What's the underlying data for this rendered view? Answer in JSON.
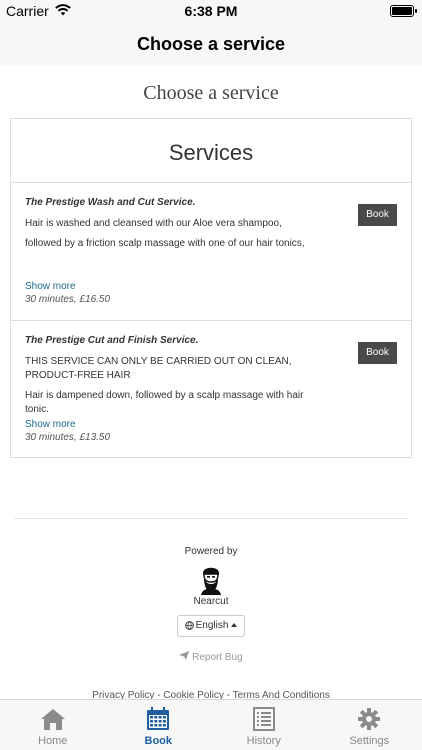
{
  "status_bar": {
    "carrier": "Carrier",
    "time": "6:38 PM"
  },
  "nav": {
    "title": "Choose a service"
  },
  "main": {
    "heading": "Choose a service",
    "panel_title": "Services",
    "book_label": "Book",
    "show_more_label": "Show more",
    "services": [
      {
        "name": "The Prestige Wash and Cut Service.",
        "description": [
          "Hair is washed and cleansed with our Aloe vera shampoo,",
          "followed by a friction scalp massage with one of our hair tonics,"
        ],
        "meta": "30 minutes, £16.50"
      },
      {
        "name": "The Prestige Cut and Finish Service.",
        "description": [
          "THIS SERVICE CAN ONLY BE CARRIED OUT ON CLEAN, PRODUCT-FREE HAIR",
          "Hair is dampened down, followed by a scalp massage with hair tonic."
        ],
        "meta": "30 minutes, £13.50"
      }
    ]
  },
  "footer": {
    "powered_by": "Powered by",
    "brand": "Nearcut",
    "language": "English",
    "report_bug": "Report Bug",
    "legal": "Privacy Policy - Cookie Policy - Terms And Conditions"
  },
  "tabs": [
    {
      "label": "Home",
      "icon": "home-icon",
      "active": false
    },
    {
      "label": "Book",
      "icon": "calendar-icon",
      "active": true
    },
    {
      "label": "History",
      "icon": "list-icon",
      "active": false
    },
    {
      "label": "Settings",
      "icon": "gear-icon",
      "active": false
    }
  ],
  "colors": {
    "accent": "#1f5fa0",
    "link": "#1b6a8a",
    "book_button": "#4a4a4a"
  }
}
